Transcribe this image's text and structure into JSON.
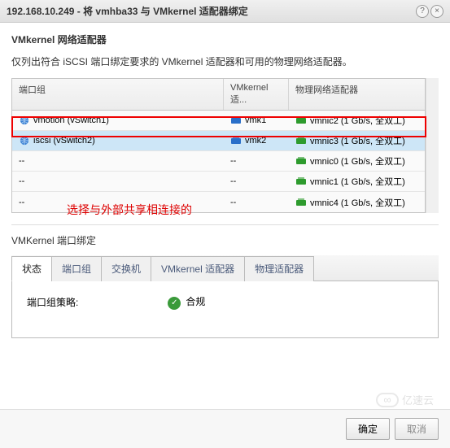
{
  "titlebar": {
    "title": "192.168.10.249 - 将 vmhba33 与 VMkernel 适配器绑定"
  },
  "section": {
    "heading": "VMkernel 网络适配器",
    "description": "仅列出符合 iSCSI 端口绑定要求的 VMkernel 适配器和可用的物理网络适配器。"
  },
  "table": {
    "headers": {
      "port_group": "端口组",
      "vmkernel": "VMkernel 适...",
      "physical": "物理网络适配器"
    },
    "rows": [
      {
        "pg": "vmotion (vSwitch1)",
        "vmk": "vmk1",
        "phy": "vmnic2 (1 Gb/s, 全双工)",
        "pg_icon": true,
        "vmk_icon": true,
        "selected": false
      },
      {
        "pg": "iscsi (vSwitch2)",
        "vmk": "vmk2",
        "phy": "vmnic3 (1 Gb/s, 全双工)",
        "pg_icon": true,
        "vmk_icon": true,
        "selected": true
      },
      {
        "pg": "--",
        "vmk": "--",
        "phy": "vmnic0 (1 Gb/s, 全双工)",
        "pg_icon": false,
        "vmk_icon": false,
        "selected": false
      },
      {
        "pg": "--",
        "vmk": "--",
        "phy": "vmnic1 (1 Gb/s, 全双工)",
        "pg_icon": false,
        "vmk_icon": false,
        "selected": false
      },
      {
        "pg": "--",
        "vmk": "--",
        "phy": "vmnic4 (1 Gb/s, 全双工)",
        "pg_icon": false,
        "vmk_icon": false,
        "selected": false
      }
    ]
  },
  "annotation": {
    "text": "选择与外部共享相连接的"
  },
  "lower": {
    "heading": "VMKernel 端口绑定",
    "tabs": [
      "状态",
      "端口组",
      "交换机",
      "VMkernel 适配器",
      "物理适配器"
    ],
    "active_tab": 0,
    "policy_label": "端口组策略:",
    "policy_value": "合规"
  },
  "footer": {
    "ok": "确定",
    "cancel": "取消"
  },
  "watermark": {
    "text": "亿速云"
  }
}
